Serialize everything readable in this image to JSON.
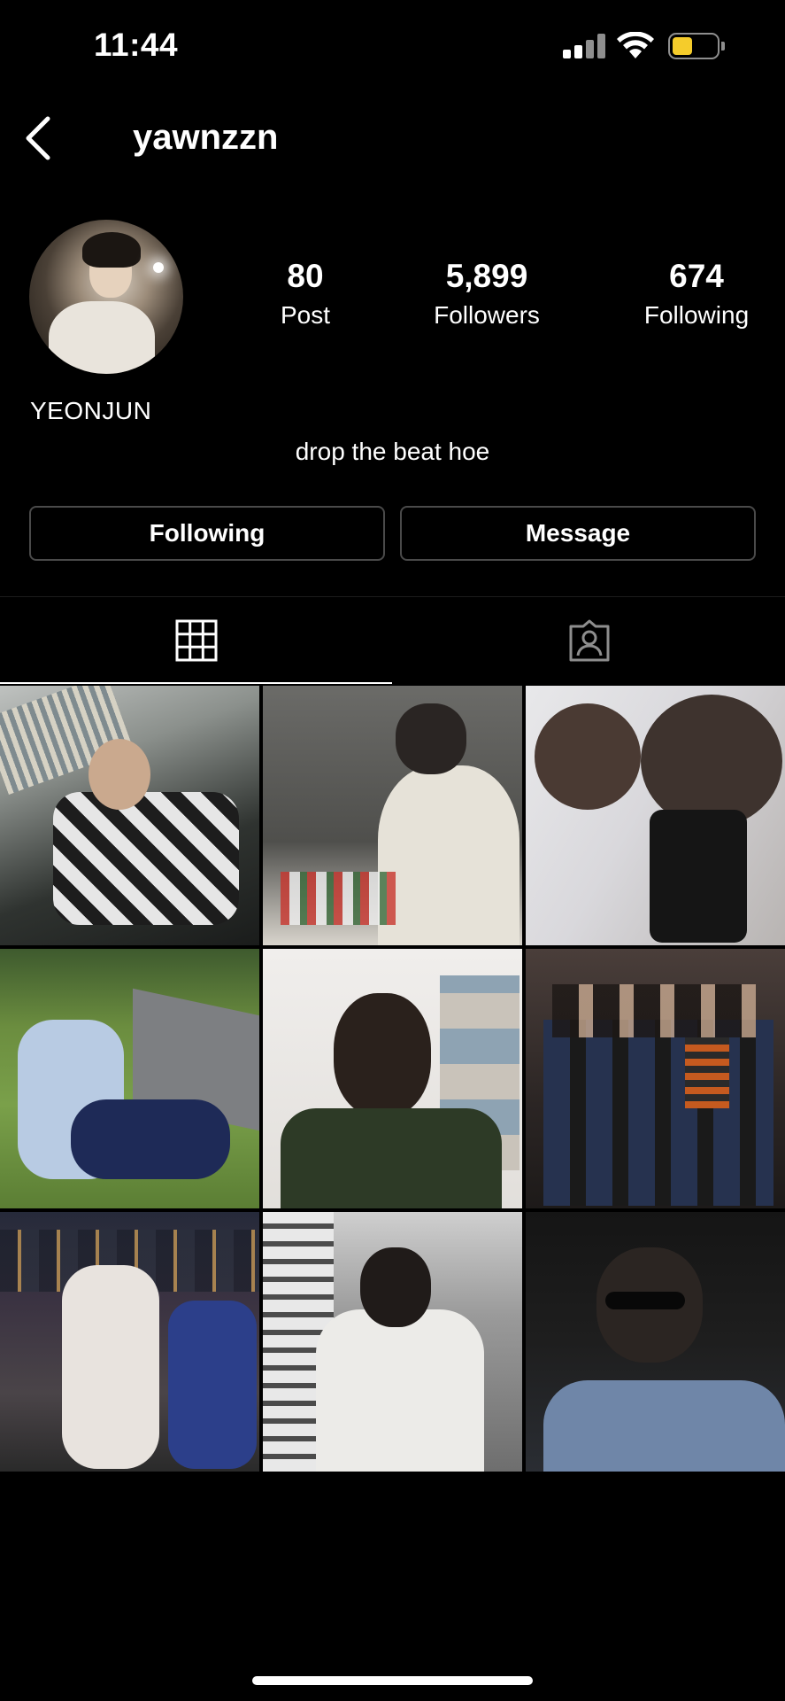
{
  "status_bar": {
    "time": "11:44",
    "signal_icon": "cellular-signal-icon",
    "wifi_icon": "wifi-icon",
    "battery_icon": "battery-icon",
    "battery_level": 0.45,
    "battery_color": "#f5cc2b"
  },
  "header": {
    "back_icon": "chevron-left-icon",
    "username": "yawnzzn"
  },
  "profile": {
    "avatar": "profile-photo",
    "stats": {
      "posts": {
        "value": "80",
        "label": "Post"
      },
      "followers": {
        "value": "5,899",
        "label": "Followers"
      },
      "following": {
        "value": "674",
        "label": "Following"
      }
    },
    "display_name": "YEONJUN",
    "bio": "drop the beat hoe"
  },
  "actions": {
    "following_label": "Following",
    "message_label": "Message"
  },
  "tabs": [
    {
      "icon": "grid-icon",
      "active": true
    },
    {
      "icon": "tagged-person-icon",
      "active": false
    }
  ],
  "posts": [
    {
      "description": "photo"
    },
    {
      "description": "photo"
    },
    {
      "description": "photo"
    },
    {
      "description": "photo"
    },
    {
      "description": "photo"
    },
    {
      "description": "photo"
    },
    {
      "description": "photo"
    },
    {
      "description": "photo"
    },
    {
      "description": "photo"
    }
  ],
  "colors": {
    "background": "#000000",
    "text": "#ffffff",
    "button_border": "#4a4a4a"
  }
}
